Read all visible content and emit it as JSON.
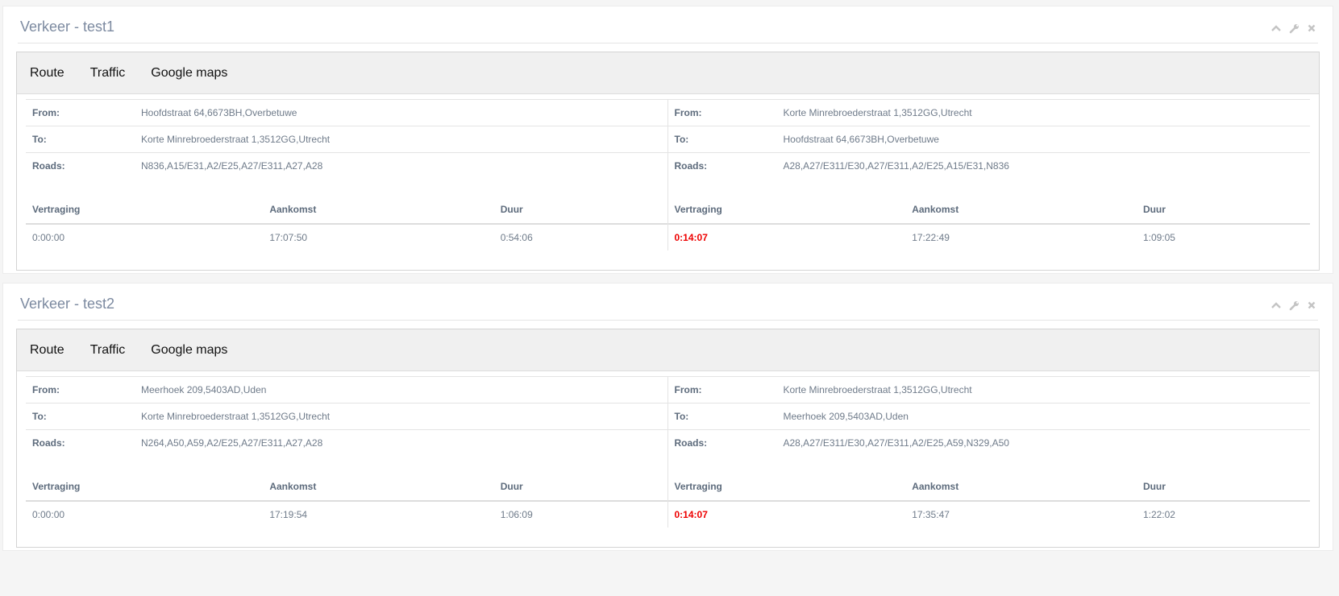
{
  "colors": {
    "delay_highlight": "#ee0000",
    "title": "#7c8aa0",
    "tab_bar_bg": "#f0f0f0"
  },
  "widgets": [
    {
      "title": "Verkeer - test1",
      "tools": [
        "chevron-up-icon",
        "wrench-icon",
        "close-icon"
      ],
      "tabs": [
        "Route",
        "Traffic",
        "Google maps"
      ],
      "routes": [
        {
          "from_label": "From:",
          "from": "Hoofdstraat 64,6673BH,Overbetuwe",
          "to_label": "To:",
          "to": "Korte Minrebroederstraat 1,3512GG,Utrecht",
          "roads_label": "Roads:",
          "roads": "N836,A15/E31,A2/E25,A27/E311,A27,A28",
          "headers": [
            "Vertraging",
            "Aankomst",
            "Duur"
          ],
          "delay": "0:00:00",
          "arrival": "17:07:50",
          "duration": "0:54:06",
          "delay_alert": false
        },
        {
          "from_label": "From:",
          "from": "Korte Minrebroederstraat 1,3512GG,Utrecht",
          "to_label": "To:",
          "to": "Hoofdstraat 64,6673BH,Overbetuwe",
          "roads_label": "Roads:",
          "roads": "A28,A27/E311/E30,A27/E311,A2/E25,A15/E31,N836",
          "headers": [
            "Vertraging",
            "Aankomst",
            "Duur"
          ],
          "delay": "0:14:07",
          "arrival": "17:22:49",
          "duration": "1:09:05",
          "delay_alert": true
        }
      ]
    },
    {
      "title": "Verkeer - test2",
      "tools": [
        "chevron-up-icon",
        "wrench-icon",
        "close-icon"
      ],
      "tabs": [
        "Route",
        "Traffic",
        "Google maps"
      ],
      "routes": [
        {
          "from_label": "From:",
          "from": "Meerhoek 209,5403AD,Uden",
          "to_label": "To:",
          "to": "Korte Minrebroederstraat 1,3512GG,Utrecht",
          "roads_label": "Roads:",
          "roads": "N264,A50,A59,A2/E25,A27/E311,A27,A28",
          "headers": [
            "Vertraging",
            "Aankomst",
            "Duur"
          ],
          "delay": "0:00:00",
          "arrival": "17:19:54",
          "duration": "1:06:09",
          "delay_alert": false
        },
        {
          "from_label": "From:",
          "from": "Korte Minrebroederstraat 1,3512GG,Utrecht",
          "to_label": "To:",
          "to": "Meerhoek 209,5403AD,Uden",
          "roads_label": "Roads:",
          "roads": "A28,A27/E311/E30,A27/E311,A2/E25,A59,N329,A50",
          "headers": [
            "Vertraging",
            "Aankomst",
            "Duur"
          ],
          "delay": "0:14:07",
          "arrival": "17:35:47",
          "duration": "1:22:02",
          "delay_alert": true
        }
      ]
    }
  ]
}
